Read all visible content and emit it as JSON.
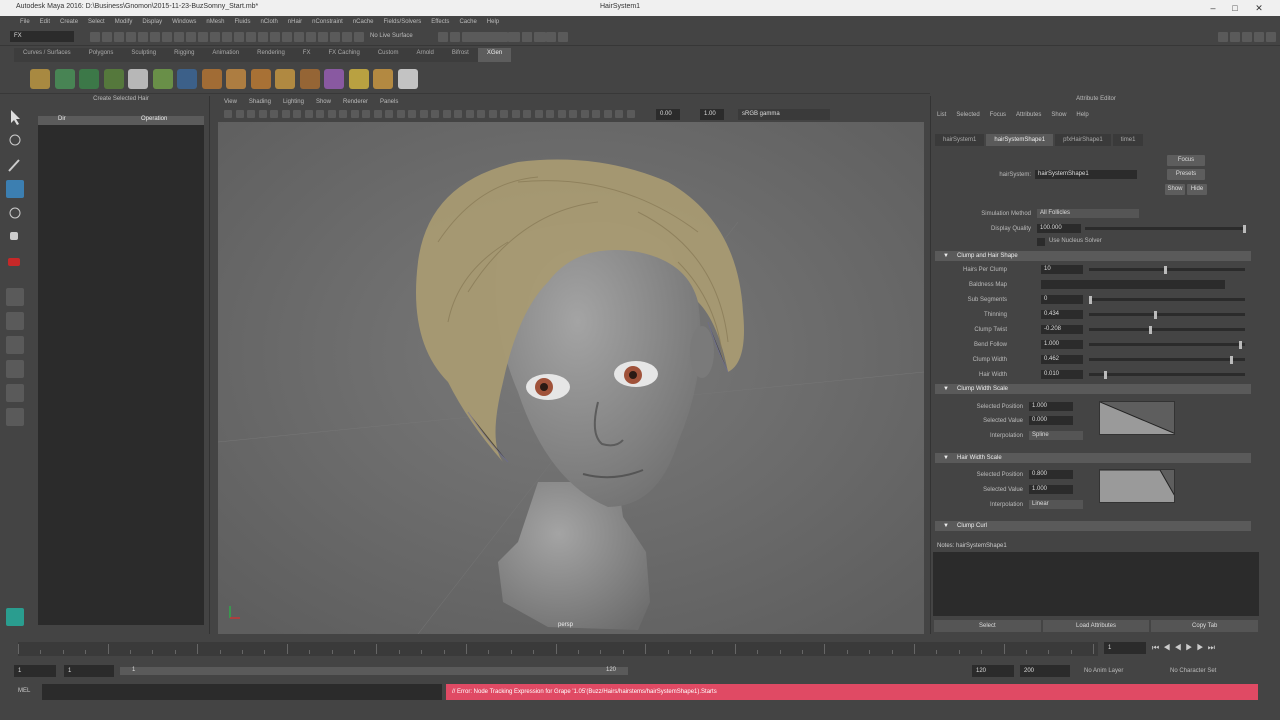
{
  "window": {
    "title": "Autodesk Maya 2016: D:\\Business\\Gnomon\\2015-11-23-BuzSomny_Start.mb*",
    "center_title": "HairSystem1"
  },
  "menubar": [
    "File",
    "Edit",
    "Create",
    "Select",
    "Modify",
    "Display",
    "Windows",
    "nMesh",
    "Fluids",
    "nCloth",
    "nHair",
    "nConstraint",
    "nCache",
    "Fields/Solvers",
    "Effects",
    "Cache",
    "Help"
  ],
  "statusline": {
    "mode": "FX",
    "live_surface": "No Live Surface"
  },
  "shelf_tabs": {
    "items": [
      "Curves / Surfaces",
      "Polygons",
      "Sculpting",
      "Rigging",
      "Animation",
      "Rendering",
      "FX",
      "FX Caching",
      "Custom",
      "Arnold",
      "Bifrost",
      "XGen"
    ],
    "active_index": 11
  },
  "outliner": {
    "title": "Create Selected Hair",
    "col1": "Dir",
    "col2": "Operation"
  },
  "viewport": {
    "menu": [
      "View",
      "Shading",
      "Lighting",
      "Show",
      "Renderer",
      "Panels"
    ],
    "gamma_label": "sRGB gamma",
    "val1": "0.00",
    "val2": "1.00",
    "camera_label": "persp"
  },
  "attr": {
    "title": "Attribute Editor",
    "menu": [
      "List",
      "Selected",
      "Focus",
      "Attributes",
      "Show",
      "Help"
    ],
    "tabs": [
      "hairSystem1",
      "hairSystemShape1",
      "pfxHairShape1",
      "time1"
    ],
    "active_tab": 1,
    "node_label": "hairSystem:",
    "node_value": "hairSystemShape1",
    "focus_btn": "Focus",
    "presets_btn": "Presets",
    "show_btn": "Show",
    "hide_btn": "Hide",
    "simulation_method_label": "Simulation Method",
    "simulation_method_value": "All Follicles",
    "display_quality_label": "Display Quality",
    "display_quality_value": "100.000",
    "use_nucleus": "Use Nucleus Solver",
    "clump_section": "Clump and Hair Shape",
    "clump_fields": [
      {
        "label": "Hairs Per Clump",
        "value": "10",
        "pos": 0.5
      },
      {
        "label": "Baldness Map",
        "value": "",
        "pos": null
      },
      {
        "label": "Sub Segments",
        "value": "0",
        "pos": 0.0
      },
      {
        "label": "Thinning",
        "value": "0.434",
        "pos": 0.43
      },
      {
        "label": "Clump Twist",
        "value": "-0.208",
        "pos": 0.4
      },
      {
        "label": "Bend Follow",
        "value": "1.000",
        "pos": 1.0
      },
      {
        "label": "Clump Width",
        "value": "0.462",
        "pos": 0.94
      },
      {
        "label": "Hair Width",
        "value": "0.010",
        "pos": 0.1
      }
    ],
    "clump_width_scale": "Clump Width Scale",
    "cws_selected_position_label": "Selected Position",
    "cws_selected_position": "1.000",
    "cws_selected_value_label": "Selected Value",
    "cws_selected_value": "0.000",
    "cws_interpolation_label": "Interpolation",
    "cws_interpolation": "Spline",
    "hair_width_scale": "Hair Width Scale",
    "hws_selected_position_label": "Selected Position",
    "hws_selected_position": "0.800",
    "hws_selected_value_label": "Selected Value",
    "hws_selected_value": "1.000",
    "hws_interpolation_label": "Interpolation",
    "hws_interpolation": "Linear",
    "clump_curl": "Clump Curl",
    "notes_label": "Notes:  hairSystemShape1",
    "bottom_buttons": [
      "Select",
      "Load Attributes",
      "Copy Tab"
    ]
  },
  "timeline": {
    "current_frame": "1"
  },
  "range": {
    "start": "1",
    "inner_start": "1",
    "slider_start": "1",
    "slider_end": "120",
    "end": "120",
    "outer_end": "200",
    "anim_layer": "No Anim Layer",
    "char_set": "No Character Set"
  },
  "cmdline": {
    "lang": "MEL",
    "error": "// Error: Node Tracking Expression for Grape '1.05'(Buzz/Hairs/hairstems/hairSystemShape1).Starts"
  },
  "colors": {
    "error_bg": "#e04a64",
    "hair": "#a89a72",
    "skin": "#8f8f8f"
  }
}
